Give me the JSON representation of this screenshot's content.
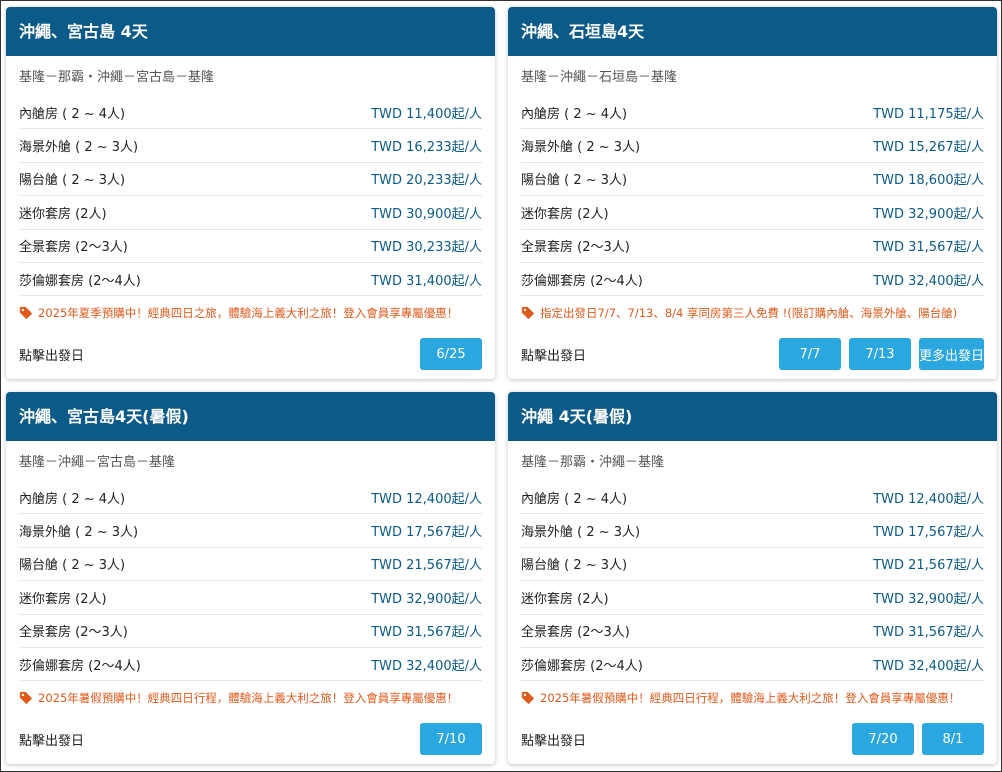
{
  "cards": [
    {
      "title": "沖繩、宮古島 4天",
      "route": "基隆－那霸・沖繩－宮古島－基隆",
      "rows": [
        {
          "name": "內艙房 ( 2 ~ 4人)",
          "price": "TWD 11,400起/人"
        },
        {
          "name": "海景外艙 ( 2 ~ 3人)",
          "price": "TWD 16,233起/人"
        },
        {
          "name": "陽台艙 ( 2 ~ 3人)",
          "price": "TWD 20,233起/人"
        },
        {
          "name": "迷你套房 (2人)",
          "price": "TWD 30,900起/人"
        },
        {
          "name": "全景套房 (2〜3人)",
          "price": "TWD 30,233起/人"
        },
        {
          "name": "莎倫娜套房 (2〜4人)",
          "price": "TWD 31,400起/人"
        }
      ],
      "promo": "2025年夏季預購中！經典四日之旅，體驗海上義大利之旅！登入會員享專屬優惠！",
      "footer_label": "點擊出發日",
      "dates": [
        "6/25"
      ]
    },
    {
      "title": "沖繩、石垣島4天",
      "route": "基隆－沖繩－石垣島－基隆",
      "rows": [
        {
          "name": "內艙房 ( 2 ~ 4人)",
          "price": "TWD 11,175起/人"
        },
        {
          "name": "海景外艙 ( 2 ~ 3人)",
          "price": "TWD 15,267起/人"
        },
        {
          "name": "陽台艙 ( 2 ~ 3人)",
          "price": "TWD 18,600起/人"
        },
        {
          "name": "迷你套房 (2人)",
          "price": "TWD 32,900起/人"
        },
        {
          "name": "全景套房 (2〜3人)",
          "price": "TWD 31,567起/人"
        },
        {
          "name": "莎倫娜套房 (2〜4人)",
          "price": "TWD 32,400起/人"
        }
      ],
      "promo": "指定出發日7/7、7/13、8/4 享同房第三人免費 !(限訂購內艙、海景外艙、陽台艙)",
      "footer_label": "點擊出發日",
      "dates": [
        "7/7",
        "7/13",
        "更多出發日"
      ]
    },
    {
      "title": "沖繩、宮古島4天(暑假)",
      "route": "基隆－沖繩－宮古島－基隆",
      "rows": [
        {
          "name": "內艙房 ( 2 ~ 4人)",
          "price": "TWD 12,400起/人"
        },
        {
          "name": "海景外艙 ( 2 ~ 3人)",
          "price": "TWD 17,567起/人"
        },
        {
          "name": "陽台艙 ( 2 ~ 3人)",
          "price": "TWD 21,567起/人"
        },
        {
          "name": "迷你套房 (2人)",
          "price": "TWD 32,900起/人"
        },
        {
          "name": "全景套房 (2〜3人)",
          "price": "TWD 31,567起/人"
        },
        {
          "name": "莎倫娜套房 (2〜4人)",
          "price": "TWD 32,400起/人"
        }
      ],
      "promo": "2025年暑假預購中！經典四日行程，體驗海上義大利之旅！登入會員享專屬優惠！",
      "footer_label": "點擊出發日",
      "dates": [
        "7/10"
      ]
    },
    {
      "title": "沖繩 4天(暑假)",
      "route": "基隆－那霸・沖繩－基隆",
      "rows": [
        {
          "name": "內艙房 ( 2 ~ 4人)",
          "price": "TWD 12,400起/人"
        },
        {
          "name": "海景外艙 ( 2 ~ 3人)",
          "price": "TWD 17,567起/人"
        },
        {
          "name": "陽台艙 ( 2 ~ 3人)",
          "price": "TWD 21,567起/人"
        },
        {
          "name": "迷你套房 (2人)",
          "price": "TWD 32,900起/人"
        },
        {
          "name": "全景套房 (2〜3人)",
          "price": "TWD 31,567起/人"
        },
        {
          "name": "莎倫娜套房 (2〜4人)",
          "price": "TWD 32,400起/人"
        }
      ],
      "promo": "2025年暑假預購中！經典四日行程，體驗海上義大利之旅！登入會員享專屬優惠！",
      "footer_label": "點擊出發日",
      "dates": [
        "7/20",
        "8/1"
      ]
    }
  ],
  "colors": {
    "header_bg": "#0b5a87",
    "price": "#0b5a87",
    "promo": "#e05a1c",
    "date_button": "#2aa7df"
  },
  "icons": {
    "promo": "tag-icon"
  }
}
